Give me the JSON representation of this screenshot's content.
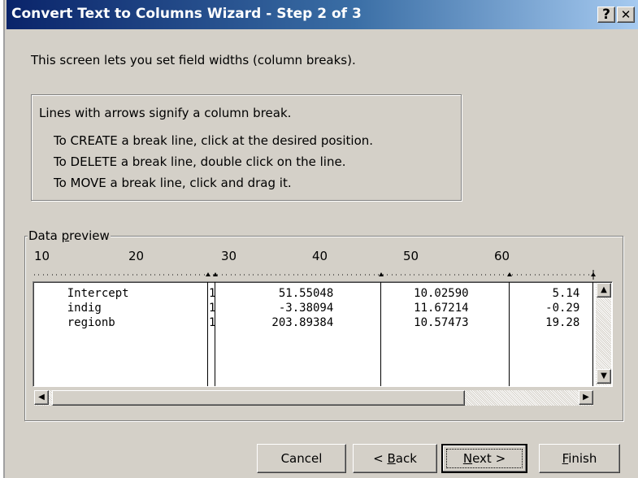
{
  "window": {
    "title": "Convert Text to Columns Wizard - Step 2 of 3",
    "help_label": "?",
    "close_label": "✕"
  },
  "intro_text": "This screen lets you set field widths (column breaks).",
  "info": {
    "line1": "Lines with arrows signify a column break.",
    "line2": "To CREATE a break line, click at the desired position.",
    "line3": "To DELETE a break line, double click on the line.",
    "line4": "To MOVE a break line, click and drag it."
  },
  "preview_group": {
    "label_prefix": "Data ",
    "label_accel": "p",
    "label_suffix": "review",
    "ruler_labels": [
      "10",
      "20",
      "30",
      "40",
      "50",
      "60"
    ],
    "rows": [
      {
        "c1": "    Intercept",
        "c2": "1",
        "c3": "         51.55048",
        "c4": "     10.02590",
        "c5": "      5.14"
      },
      {
        "c1": "    indig",
        "c2": "1",
        "c3": "         -3.38094",
        "c4": "     11.67214",
        "c5": "     -0.29"
      },
      {
        "c1": "    regionb",
        "c2": "1",
        "c3": "        203.89384",
        "c4": "     10.57473",
        "c5": "     19.28"
      }
    ]
  },
  "buttons": {
    "cancel": "Cancel",
    "back_prefix": "< ",
    "back_accel": "B",
    "back_suffix": "ack",
    "next_accel": "N",
    "next_suffix": "ext >",
    "finish_accel": "F",
    "finish_suffix": "inish"
  },
  "colors": {
    "titlebar_start": "#0a246a",
    "titlebar_end": "#a6caf0",
    "dialog_bg": "#d4d0c8"
  }
}
